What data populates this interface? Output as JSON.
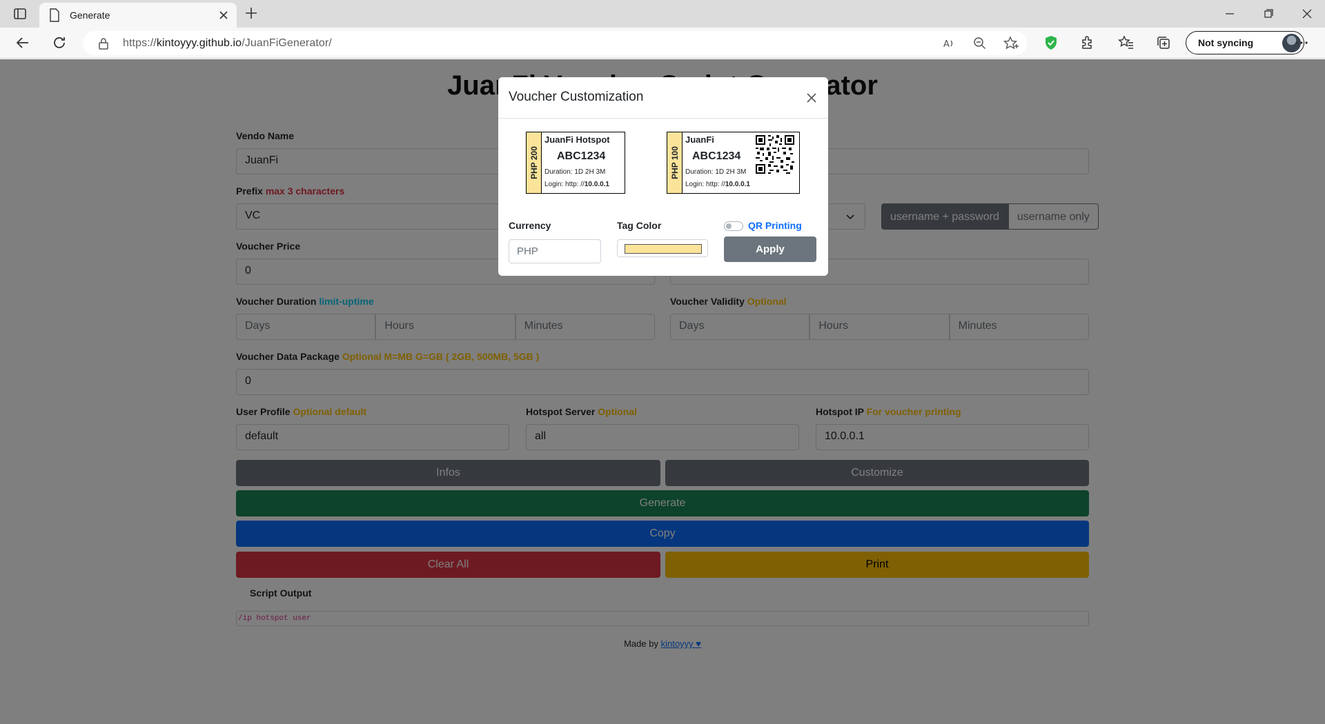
{
  "browser": {
    "tab_title": "Generate",
    "url_scheme": "https://",
    "url_host": "kintoyyy.github.io",
    "url_path": "/JuanFiGenerator/",
    "sync_label": "Not syncing"
  },
  "page": {
    "title": "JuanFi Voucher Script Generator",
    "vendo_label": "Vendo Name",
    "vendo_value": "JuanFi",
    "prefix_label": "Prefix",
    "prefix_hint": "max 3 characters",
    "prefix_value": "VC",
    "mode_on": "username + password",
    "mode_off": "username only",
    "price_label": "Voucher Price",
    "price_value": "0",
    "duration_label": "Voucher Duration",
    "duration_hint": "limit-uptime",
    "validity_label": "Voucher Validity",
    "validity_hint": "Optional",
    "days_ph": "Days",
    "hours_ph": "Hours",
    "minutes_ph": "Minutes",
    "data_label": "Voucher Data Package",
    "data_hint": "Optional M=MB G=GB ( 2GB, 500MB, 5GB )",
    "data_value": "0",
    "profile_label": "User Profile",
    "profile_hint": "Optional default",
    "profile_value": "default",
    "server_label": "Hotspot Server",
    "server_hint": "Optional",
    "server_value": "all",
    "ip_label": "Hotspot IP",
    "ip_hint": "For voucher printing",
    "ip_value": "10.0.0.1",
    "btn_infos": "Infos",
    "btn_customize": "Customize",
    "btn_generate": "Generate",
    "btn_copy": "Copy",
    "btn_clear": "Clear All",
    "btn_print": "Print",
    "script_label": "Script Output",
    "script_text": "/ip hotspot user",
    "made_by": "Made by",
    "author": "kintoyyy",
    "colors": {
      "dark": "#6c757d",
      "green": "#198754",
      "blue": "#0d6efd",
      "red": "#dc3545",
      "yellow": "#ffc107"
    }
  },
  "modal": {
    "title": "Voucher Customization",
    "voucher1": {
      "tag": "PHP 200",
      "name": "JuanFi Hotspot",
      "code": "ABC1234",
      "duration": "Duration: 1D 2H 3M",
      "login_prefix": "Login: http: //",
      "login_ip": "10.0.0.1"
    },
    "voucher2": {
      "tag": "PHP 100",
      "name": "JuanFi",
      "code": "ABC1234",
      "duration": "Duration: 1D 2H 3M",
      "login_prefix": "Login: http: //",
      "login_ip": "10.0.0.1"
    },
    "currency_label": "Currency",
    "currency_value": "PHP",
    "tag_color_label": "Tag Color",
    "tag_color": "#fbe49a",
    "qr_label": "QR Printing",
    "qr_enabled": false,
    "apply_label": "Apply"
  }
}
